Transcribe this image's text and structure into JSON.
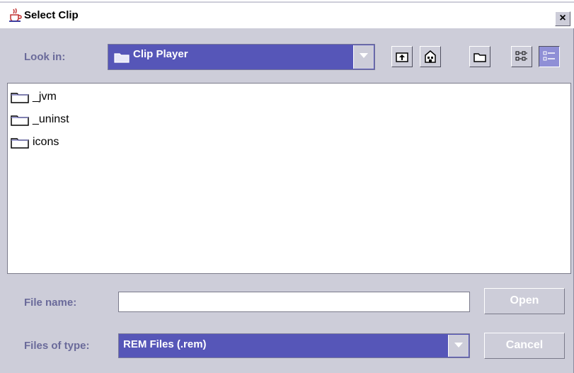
{
  "window": {
    "title": "Select Clip",
    "close_label": "×"
  },
  "toolbar": {
    "look_in_label": "Look in:",
    "look_in_value": "Clip Player",
    "buttons": [
      {
        "name": "up-one-level",
        "icon": "up-folder-icon"
      },
      {
        "name": "home",
        "icon": "home-icon"
      },
      {
        "name": "create-new-folder",
        "icon": "new-folder-icon"
      },
      {
        "name": "list-view",
        "icon": "list-view-icon",
        "selected": false
      },
      {
        "name": "details-view",
        "icon": "details-view-icon",
        "selected": true
      }
    ]
  },
  "files": [
    {
      "name": "_jvm",
      "icon": "folder-icon"
    },
    {
      "name": "_uninst",
      "icon": "folder-icon"
    },
    {
      "name": "icons",
      "icon": "folder-icon"
    }
  ],
  "form": {
    "file_name_label": "File name:",
    "file_name_value": "",
    "files_of_type_label": "Files of type:",
    "files_of_type_value": "REM Files (.rem)",
    "open_label": "Open",
    "cancel_label": "Cancel"
  },
  "colors": {
    "selection": "#5656b8",
    "label": "#6a6a9a",
    "background": "#cdcdd9"
  }
}
